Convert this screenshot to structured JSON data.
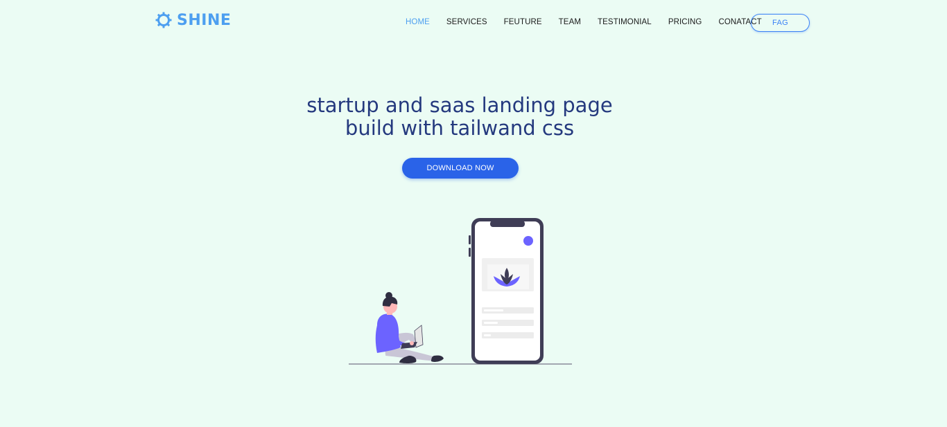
{
  "brand": {
    "name": "SHINE",
    "icon": "gear-icon",
    "color": "#4d9ff0"
  },
  "nav": {
    "items": [
      {
        "label": "HOME",
        "active": true
      },
      {
        "label": "SERVICES",
        "active": false
      },
      {
        "label": "FEUTURE",
        "active": false
      },
      {
        "label": "TEAM",
        "active": false
      },
      {
        "label": "TESTIMONIAL",
        "active": false
      },
      {
        "label": "PRICING",
        "active": false
      },
      {
        "label": "CONATACT",
        "active": false
      }
    ],
    "cta_label": "FAG"
  },
  "hero": {
    "title_line1": "startup and saas landing page",
    "title_line2": "build with tailwand css",
    "button_label": "DOWNLOAD NOW",
    "illustration": "person-with-laptop-and-phone-illustration"
  },
  "colors": {
    "background": "#ebfcf4",
    "accent": "#2a63e8",
    "title": "#24397e",
    "illustration_purple": "#6c63ff",
    "phone_frame": "#3f3d56"
  }
}
